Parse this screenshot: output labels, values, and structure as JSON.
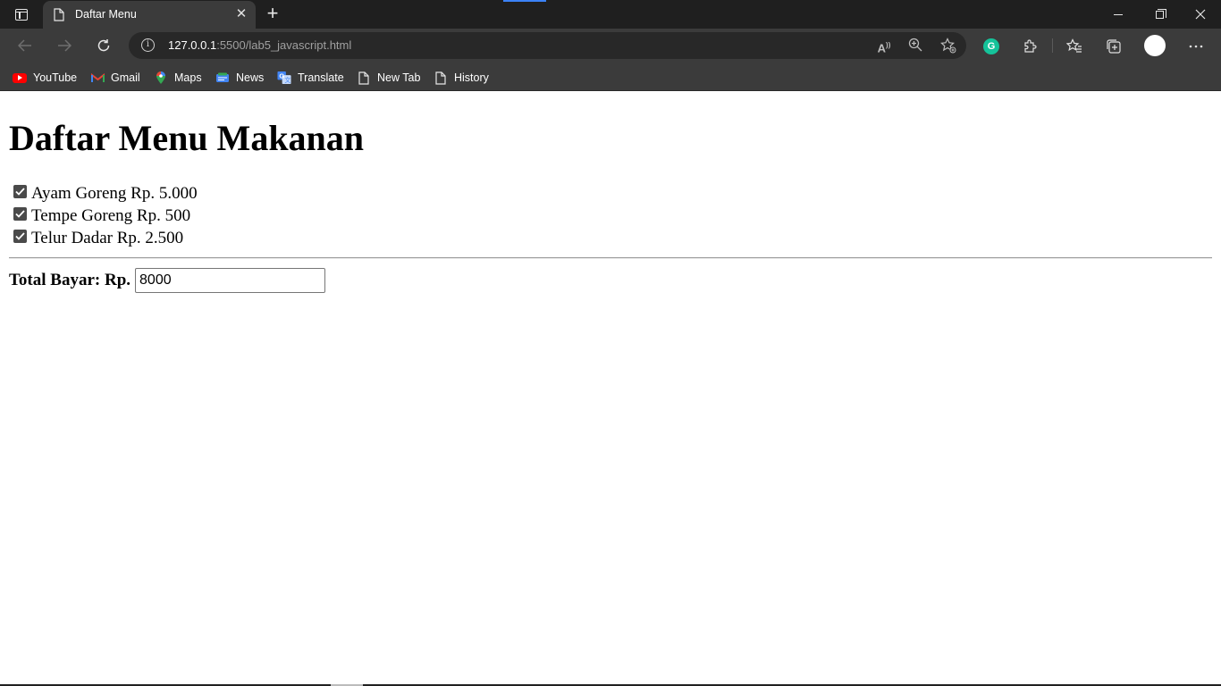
{
  "browser": {
    "tab": {
      "title": "Daftar Menu",
      "close_glyph": "✕"
    },
    "new_tab_glyph": "+",
    "address": {
      "host": "127.0.0.1",
      "path": ":5500/lab5_javascript.html"
    },
    "bookmarks": [
      {
        "label": "YouTube",
        "icon": "youtube-icon"
      },
      {
        "label": "Gmail",
        "icon": "gmail-icon"
      },
      {
        "label": "Maps",
        "icon": "maps-icon"
      },
      {
        "label": "News",
        "icon": "news-icon"
      },
      {
        "label": "Translate",
        "icon": "translate-icon"
      },
      {
        "label": "New Tab",
        "icon": "page-icon"
      },
      {
        "label": "History",
        "icon": "page-icon"
      }
    ],
    "colors": {
      "chrome_dark": "#1f1f1f",
      "chrome": "#3b3b3b",
      "grammarly": "#15c39a",
      "accent": "#3b82f6"
    }
  },
  "page": {
    "title": "Daftar Menu Makanan",
    "menu_items": [
      {
        "label": "Ayam Goreng Rp. 5.000",
        "checked": true
      },
      {
        "label": "Tempe Goreng Rp. 500",
        "checked": true
      },
      {
        "label": "Telur Dadar Rp. 2.500",
        "checked": true
      }
    ],
    "total": {
      "label": "Total Bayar: Rp.",
      "value": "8000"
    }
  }
}
